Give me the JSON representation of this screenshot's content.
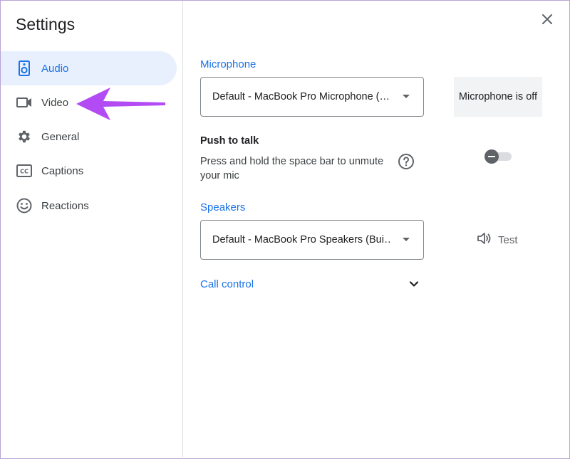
{
  "dialog": {
    "title": "Settings"
  },
  "sidebar": {
    "items": [
      {
        "label": "Audio",
        "icon": "speaker-icon",
        "active": true
      },
      {
        "label": "Video",
        "icon": "video-camera-icon",
        "active": false
      },
      {
        "label": "General",
        "icon": "gear-icon",
        "active": false
      },
      {
        "label": "Captions",
        "icon": "closed-captions-icon",
        "active": false
      },
      {
        "label": "Reactions",
        "icon": "smiley-icon",
        "active": false
      }
    ]
  },
  "audio": {
    "microphone": {
      "label": "Microphone",
      "selected": "Default - MacBook Pro Microphone (…",
      "status": "Microphone is off"
    },
    "push_to_talk": {
      "title": "Push to talk",
      "description": "Press and hold the space bar to unmute your mic",
      "enabled": false
    },
    "speakers": {
      "label": "Speakers",
      "selected": "Default - MacBook Pro Speakers (Bui…",
      "test_label": "Test"
    },
    "call_control": {
      "label": "Call control"
    }
  },
  "colors": {
    "accent": "#1a73e8",
    "active_nav_bg": "#e8f0fe",
    "annotation_arrow": "#b24bf3"
  }
}
